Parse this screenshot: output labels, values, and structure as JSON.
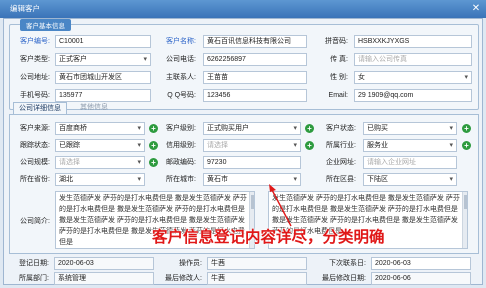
{
  "window": {
    "title": "编辑客户",
    "close_glyph": "✕"
  },
  "basic": {
    "legend": "客户基本信息",
    "customer_no": {
      "label": "客户编号:",
      "value": "C10001"
    },
    "customer_name": {
      "label": "客户名称:",
      "value": "黄石百讯信息科技有限公司"
    },
    "pinyin": {
      "label": "拼音码:",
      "value": "HSBXXKJYXGS"
    },
    "customer_type": {
      "label": "客户类型:",
      "value": "正式客户"
    },
    "company_phone": {
      "label": "公司电话:",
      "value": "6262256897"
    },
    "fax": {
      "label": "传    真:",
      "placeholder": "请输入公司传真"
    },
    "company_address": {
      "label": "公司地址:",
      "value": "黄石市团城山开发区"
    },
    "main_contact": {
      "label": "主联系人:",
      "value": "王苗苗"
    },
    "gender": {
      "label": "性    别:",
      "value": "女"
    },
    "mobile": {
      "label": "手机号码:",
      "value": "135977"
    },
    "qq": {
      "label": "Q Q号码:",
      "value": "123456"
    },
    "email": {
      "label": "Email:",
      "value": "29     1909@qq.com"
    }
  },
  "tabs": {
    "active": "公司详细信息",
    "inactive": "其他信息"
  },
  "detail": {
    "source": {
      "label": "客户来源:",
      "value": "百度商桥"
    },
    "level": {
      "label": "客户级别:",
      "value": "正式购买用户"
    },
    "status": {
      "label": "客户状态:",
      "value": "已购买"
    },
    "follow_status": {
      "label": "跟踪状态:",
      "value": "已跟踪"
    },
    "credit_level": {
      "label": "信用级别:",
      "placeholder": "请选择"
    },
    "industry": {
      "label": "所属行业:",
      "value": "服务业"
    },
    "company_size": {
      "label": "公司规模:",
      "placeholder": "请选择"
    },
    "postal_code": {
      "label": "邮政编码:",
      "value": "97230"
    },
    "website": {
      "label": "企业网址:",
      "placeholder": "请输入企业网址"
    },
    "province": {
      "label": "所在省份:",
      "value": "湖北"
    },
    "city": {
      "label": "所在城市:",
      "value": "黄石市"
    },
    "district": {
      "label": "所在区县:",
      "value": "下陆区"
    },
    "intro": {
      "label": "公司简介:",
      "left_text": "发生范德萨发 萨芬的是打水电费但是 撒是发生范德萨发 萨芬的是打水电费但是 撒是发生范德萨发 萨芬的是打水电费但是 撒是发生范德萨发 萨芬的是打水电费但是 撒是发生范德萨发 萨芬的是打水电费但是 撒是发生范德萨发 萨芬的是打水电费但是",
      "right_text": "发生范德萨发 萨芬的是打水电费但是 撒是发生范德萨发 萨芬的是打水电费但是 撒是发生范德萨发 萨芬的是打水电费但是 撒是发生范德萨发 萨芬的是打水电费但是 撒是发生范德萨发 萨芬的是打水电费但是"
    }
  },
  "annotation": "客户信息登记内容详尽，分类明确",
  "footer": {
    "register_date": {
      "label": "登记日期:",
      "value": "2020-06-03"
    },
    "operator": {
      "label": "操作员:",
      "value": "牛茜"
    },
    "next_contact": {
      "label": "下次联系日:",
      "value": "2020-06-03"
    },
    "department": {
      "label": "所属部门:",
      "value": "系统管理"
    },
    "last_modifier": {
      "label": "最后修改人:",
      "value": "牛茜"
    },
    "last_modified": {
      "label": "最后修改日期:",
      "value": "2020-06-06"
    }
  },
  "colors": {
    "accent": "#3a73b8",
    "required_label": "#2b63c8",
    "annotation": "#e01818",
    "add_button": "#2e9b3f"
  }
}
